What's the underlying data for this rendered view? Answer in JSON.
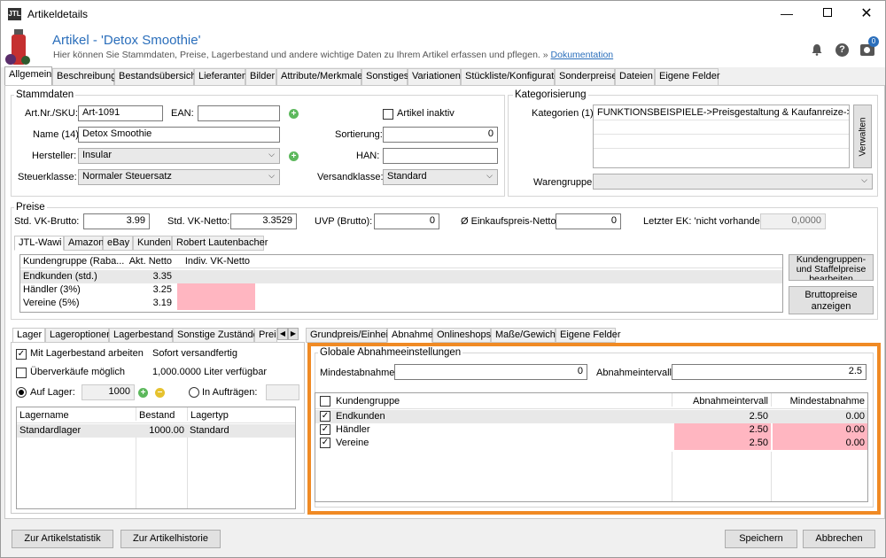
{
  "window": {
    "title": "Artikeldetails",
    "app_icon": "jtl-logo"
  },
  "header": {
    "title": "Artikel - 'Detox Smoothie'",
    "subtitle": "Hier können Sie Stammdaten, Preise, Lagerbestand und andere wichtige Daten zu Ihrem Artikel erfassen und pflegen. »",
    "doc_link": "Dokumentation",
    "badge": "0"
  },
  "tabs": [
    "Allgemein",
    "Beschreibung",
    "Bestandsübersicht",
    "Lieferanten",
    "Bilder",
    "Attribute/Merkmale",
    "Sonstiges",
    "Variationen",
    "Stückliste/Konfigurator",
    "Sonderpreise",
    "Dateien",
    "Eigene Felder"
  ],
  "stammdaten": {
    "title": "Stammdaten",
    "artnr_label": "Art.Nr./SKU:",
    "artnr": "Art-1091",
    "ean_label": "EAN:",
    "ean": "",
    "inaktiv_label": "Artikel inaktiv",
    "name_label": "Name (14):",
    "name": "Detox Smoothie",
    "sortierung_label": "Sortierung:",
    "sortierung": "0",
    "hersteller_label": "Hersteller:",
    "hersteller": "Insular",
    "han_label": "HAN:",
    "han": "",
    "steuer_label": "Steuerklasse:",
    "steuer": "Normaler Steuersatz",
    "versand_label": "Versandklasse:",
    "versand": "Standard"
  },
  "kategorisierung": {
    "title": "Kategorisierung",
    "kat_label": "Kategorien (1):",
    "kat_value": "FUNKTIONSBEISPIELE->Preisgestaltung & Kaufanreize->...",
    "verwalten": "Verwalten",
    "warengruppe_label": "Warengruppe:",
    "warengruppe": ""
  },
  "preise": {
    "title": "Preise",
    "vk_brutto_label": "Std. VK-Brutto:",
    "vk_brutto": "3.99",
    "vk_netto_label": "Std. VK-Netto:",
    "vk_netto": "3.3529",
    "uvp_label": "UVP (Brutto):",
    "uvp": "0",
    "ek_label": "Ø Einkaufspreis-Netto:",
    "ek": "0",
    "letzter_ek_label": "Letzter EK: 'nicht vorhanden'",
    "letzter_ek": "0,0000",
    "subtabs": [
      "JTL-Wawi",
      "Amazon",
      "eBay",
      "Kunden",
      "Robert Lautenbacher"
    ],
    "headers": [
      "Kundengruppe (Raba...",
      "Akt. Netto",
      "Indiv. VK-Netto"
    ],
    "rows": [
      {
        "name": "Endkunden (std.)",
        "netto": "3.35",
        "indiv": ""
      },
      {
        "name": "Händler (3%)",
        "netto": "3.25",
        "indiv": ""
      },
      {
        "name": "Vereine (5%)",
        "netto": "3.19",
        "indiv": ""
      }
    ],
    "btn_staffel": "Kundengruppen- und Staffelpreise bearbeiten",
    "btn_brutto": "Bruttopreise anzeigen"
  },
  "lager": {
    "tabs": [
      "Lager",
      "Lageroptionen",
      "Lagerbestand",
      "Sonstige Zustände",
      "Preis"
    ],
    "mit_lager": "Mit Lagerbestand arbeiten",
    "sofort": "Sofort versandfertig",
    "ueberverkauf": "Überverkäufe möglich",
    "verfuegbar": "1,000.0000 Liter verfügbar",
    "auf_lager": "Auf Lager:",
    "auf_lager_value": "1000",
    "in_auftraegen": "In Aufträgen:",
    "headers": [
      "Lagername",
      "Bestand",
      "Lagertyp"
    ],
    "rows": [
      {
        "name": "Standardlager",
        "bestand": "1000.00",
        "typ": "Standard"
      }
    ]
  },
  "abnahme": {
    "tabs": [
      "Grundpreis/Einheit",
      "Abnahme",
      "Onlineshops",
      "Maße/Gewicht",
      "Eigene Felder"
    ],
    "group_title": "Globale Abnahmeeinstellungen",
    "min_label": "Mindestabnahme:",
    "min_value": "0",
    "interval_label": "Abnahmeintervall:",
    "interval_value": "2.5",
    "headers": [
      "Kundengruppe",
      "Abnahmeintervall",
      "Mindestabnahme"
    ],
    "rows": [
      {
        "name": "Endkunden",
        "interval": "2.50",
        "min": "0.00"
      },
      {
        "name": "Händler",
        "interval": "2.50",
        "min": "0.00"
      },
      {
        "name": "Vereine",
        "interval": "2.50",
        "min": "0.00"
      }
    ],
    "highlight_color": "#f08a24"
  },
  "footer": {
    "statistik": "Zur Artikelstatistik",
    "historie": "Zur Artikelhistorie",
    "speichern": "Speichern",
    "abbrechen": "Abbrechen"
  }
}
